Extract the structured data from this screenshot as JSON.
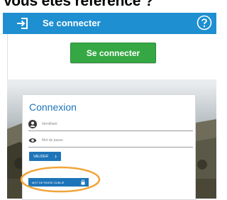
{
  "caption": "Vous êtes référencé ?",
  "topbar": {
    "title": "Se connecter"
  },
  "top_panel": {
    "button_label": "Se connecter"
  },
  "login_card": {
    "title": "Connexion",
    "identifier_placeholder": "Identifiant",
    "password_placeholder": "Mot de passe",
    "submit_label": "VALIDER",
    "forgot_label": "MOT DE PASSE OUBLIÉ"
  },
  "colors": {
    "brand_blue": "#1e8fd1",
    "button_green": "#35a843",
    "highlight_orange": "#f0a53a"
  }
}
